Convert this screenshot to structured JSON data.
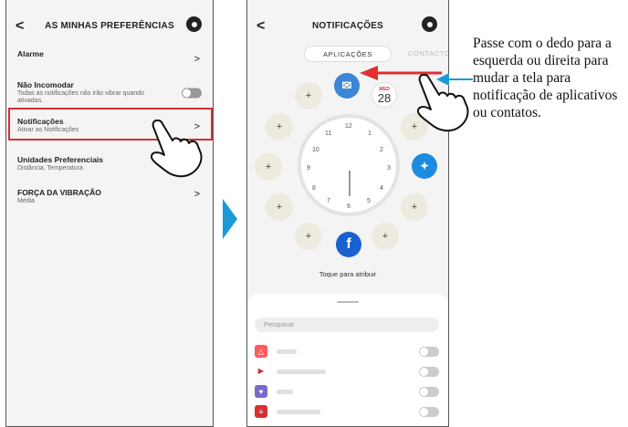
{
  "left_screen": {
    "title": "AS MINHAS PREFERÊNCIAS",
    "items": [
      {
        "label": "Alarme",
        "sublabel": "",
        "control": "chevron"
      },
      {
        "label": "Não Incomodar",
        "sublabel": "Todas as notificações não irão vibrar quando ativadas.",
        "control": "toggle"
      },
      {
        "label": "Notificações",
        "sublabel": "Ativar as Notificações",
        "control": "chevron"
      },
      {
        "label": "Unidades Preferenciais",
        "sublabel": "Distância, Temperatura",
        "control": "none"
      },
      {
        "label": "FORÇA DA VIBRAÇÃO",
        "sublabel": "Média",
        "control": "chevron"
      }
    ]
  },
  "right_screen": {
    "title": "NOTIFICAÇÕES",
    "tabs": [
      {
        "label": "APLICAÇÕES",
        "active": true
      },
      {
        "label": "CONTACTO",
        "active": false
      }
    ],
    "calendar": {
      "day": "WED",
      "date": "28"
    },
    "clock_numbers": [
      "12",
      "1",
      "2",
      "3",
      "4",
      "5",
      "6",
      "7",
      "8",
      "9",
      "10",
      "11"
    ],
    "assign_text": "Toque para atribuir",
    "search_placeholder": "Pesquisar"
  },
  "caption": "Passe com o dedo para a esquerda ou direita para mudar a tela para notificação de aplicativos ou contatos.",
  "colors": {
    "highlight": "#d63031",
    "accent": "#1a9bd8",
    "swipe_arrow": "#e03030"
  }
}
